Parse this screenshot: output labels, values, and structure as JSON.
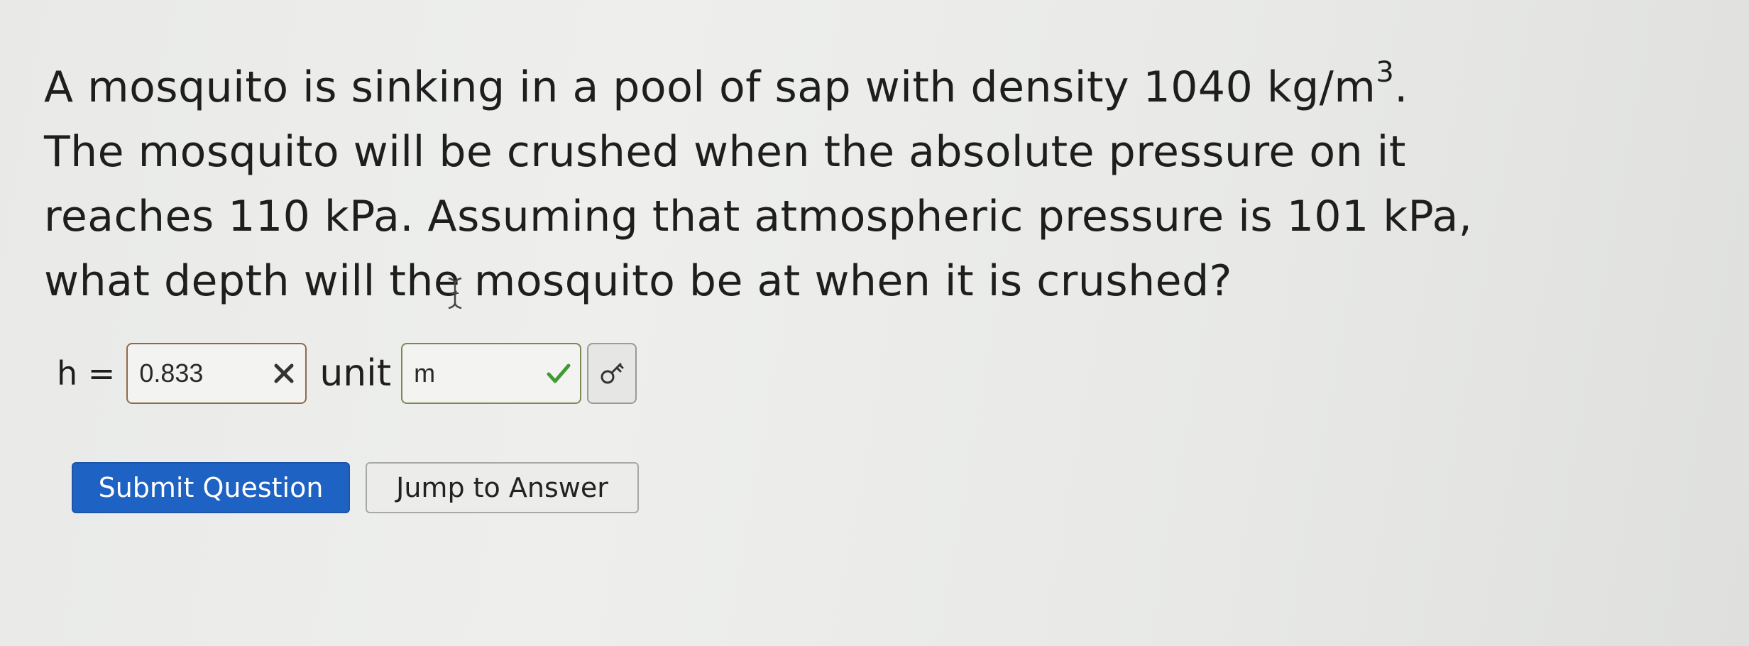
{
  "question": {
    "line1_a": "A mosquito is sinking in a pool of sap with density 1040 kg/m",
    "line1_sup": "3",
    "line1_b": ".",
    "line2": "The mosquito will be crushed when the absolute pressure on it",
    "line3": "reaches 110 kPa. Assuming that atmospheric pressure is 101 kPa,",
    "line4": "what depth will the mosquito be at when it is crushed?"
  },
  "answer": {
    "variable_label": "h =",
    "value": "0.833",
    "value_status": "incorrect",
    "unit_label": "unit",
    "unit_value": "m",
    "unit_status": "correct",
    "colors": {
      "incorrect": "#333333",
      "correct": "#3f9a32"
    }
  },
  "buttons": {
    "submit": "Submit Question",
    "jump": "Jump to Answer"
  },
  "colors": {
    "primary_button": "#1e62c4"
  },
  "icons": {
    "value_mark": "x-mark-icon",
    "unit_mark": "checkmark-icon",
    "key_button": "key-icon",
    "cursor": "text-cursor-icon"
  }
}
